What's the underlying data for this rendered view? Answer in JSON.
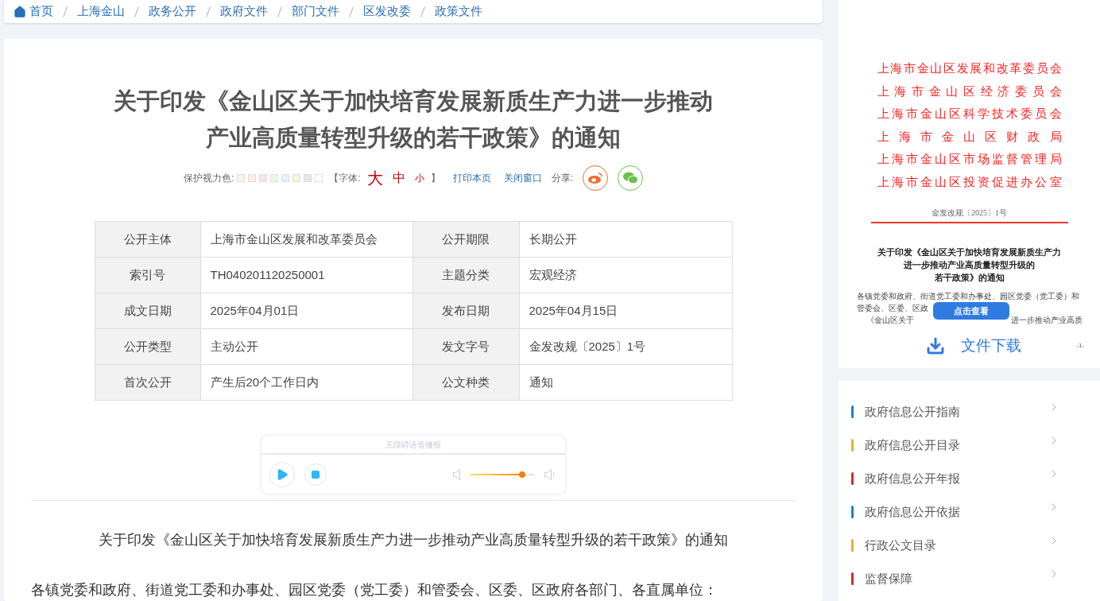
{
  "breadcrumb": [
    "首页",
    "上海金山",
    "政务公开",
    "政府文件",
    "部门文件",
    "区发改委",
    "政策文件"
  ],
  "article": {
    "title": "关于印发《金山区关于加快培育发展新质生产力进一步推动产业高质量转型升级的若干政策》的通知",
    "tools": {
      "eye_care_label": "保护视力色:",
      "swatches": [
        {
          "color": "#f5f8e6"
        },
        {
          "color": "#fbefe3"
        },
        {
          "color": "#fbe3e0"
        },
        {
          "color": "#eef8e3"
        },
        {
          "color": "#def5f9"
        },
        {
          "color": "#eef8e3"
        },
        {
          "color": "#e7e7ee"
        },
        {
          "color": "#ffffff"
        }
      ],
      "font_open": "【字体:",
      "font_sizes": [
        "大",
        "中",
        "小"
      ],
      "font_close": "】",
      "print": "打印本页",
      "close": "关闭窗口",
      "share_label": "分享:"
    },
    "meta_table": [
      {
        "label": "公开主体",
        "value": "上海市金山区发展和改革委员会",
        "label_2": "公开期限",
        "value_2": "长期公开"
      },
      {
        "label": "索引号",
        "value": "TH040201120250001",
        "label_2": "主题分类",
        "value_2": "宏观经济"
      },
      {
        "label": "成文日期",
        "value": "2025年04月01日",
        "label_2": "发布日期",
        "value_2": "2025年04月15日"
      },
      {
        "label": "公开类型",
        "value": "主动公开",
        "label_2": "发文字号",
        "value_2": "金发改规〔2025〕1号"
      },
      {
        "label": "首次公开",
        "value": "产生后20个工作日内",
        "label_2": "公文种类",
        "value_2": "通知"
      }
    ],
    "audio_player": {
      "title": "无障碍语音播报",
      "level": 0.8
    },
    "body": [
      "关于印发《金山区关于加快培育发展新质生产力进一步推动产业高质量转型升级的若干政策》的通知",
      "各镇党委和政府、街道党工委和办事处、园区党委（党工委）和管委会、区委、区政府各部门、各直属单位："
    ]
  },
  "document_preview": {
    "issuers": [
      "上海市金山区发展和改革委员会",
      "上海市金山区经济委员会",
      "上海市金山区科学技术委员会",
      "上海市金山区财政局",
      "上海市金山区市场监督管理局",
      "上海市金山区投资促进办公室"
    ],
    "doc_number": "金发改规〔2025〕1号",
    "title_lines": [
      "关于印发《金山区关于加快培育发展新质生产力",
      "进一步推动产业高质量转型升级的",
      "若干政策》的通知"
    ],
    "body_line": "各镇党委和政府、街道党工委和办事处、园区党委（党工委）和",
    "body_line_2": "管委会、区委、区政",
    "body_line_3_start": "《金山区关于",
    "body_line_3_end": "进一步推动产业高质",
    "view_button": "点击查看",
    "download": "文件下载",
    "page_number": "-1-"
  },
  "side_nav": [
    {
      "label": "政府信息公开指南",
      "color": "#1e7fd8"
    },
    {
      "label": "政府信息公开目录",
      "color": "#e6b02e"
    },
    {
      "label": "政府信息公开年报",
      "color": "#c9302c"
    },
    {
      "label": "政府信息公开依据",
      "color": "#1e7fd8"
    },
    {
      "label": "行政公文目录",
      "color": "#e6b02e"
    },
    {
      "label": "监督保障",
      "color": "#c9302c"
    }
  ]
}
